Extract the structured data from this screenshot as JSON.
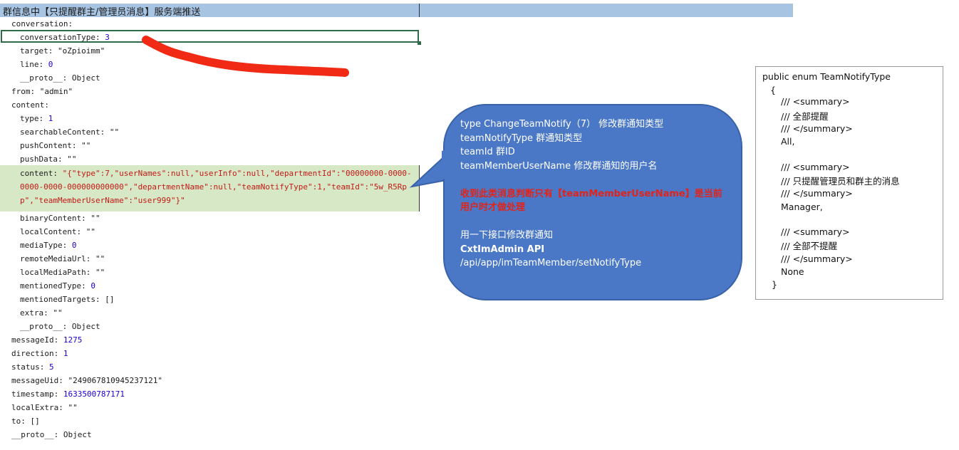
{
  "header": {
    "title": "群信息中【只提醒群主/管理员消息】服务端推送"
  },
  "tree": {
    "conversation_label": "conversation:",
    "conversationType_key": "conversationType:",
    "conversationType_val": "3",
    "target_key": "target:",
    "target_val": "\"oZpioimm\"",
    "line_key": "line:",
    "line_val": "0",
    "proto1": "__proto__: Object",
    "from_key": "from:",
    "from_val": "\"admin\"",
    "content_label": "content:",
    "type_key": "type:",
    "type_val": "1",
    "searchableContent": "searchableContent: \"\"",
    "pushContent": "pushContent: \"\"",
    "pushData": "pushData: \"\"",
    "content_key": "content:",
    "content_val": "\"{\"type\":7,\"userNames\":null,\"userInfo\":null,\"departmentId\":\"00000000-0000-0000-0000-000000000000\",\"departmentName\":null,\"teamNotifyType\":1,\"teamId\":\"5w_R5Rpp\",\"teamMemberUserName\":\"user999\"}\"",
    "binaryContent": "binaryContent: \"\"",
    "localContent": "localContent: \"\"",
    "mediaType_key": "mediaType:",
    "mediaType_val": "0",
    "remoteMediaUrl": "remoteMediaUrl: \"\"",
    "localMediaPath": "localMediaPath: \"\"",
    "mentionedType_key": "mentionedType:",
    "mentionedType_val": "0",
    "mentionedTargets": "mentionedTargets: []",
    "extra": "extra: \"\"",
    "proto2": "__proto__: Object",
    "messageId_key": "messageId:",
    "messageId_val": "1275",
    "direction_key": "direction:",
    "direction_val": "1",
    "status_key": "status:",
    "status_val": "5",
    "messageUid_key": "messageUid:",
    "messageUid_val": "\"249067810945237121\"",
    "timestamp_key": "timestamp:",
    "timestamp_val": "1633500787171",
    "localExtra": "localExtra: \"\"",
    "to": "to: []",
    "proto3": "__proto__: Object"
  },
  "bubble": {
    "l1": "type  ChangeTeamNotify（7） 修改群通知类型",
    "l2": "teamNotifyType  群通知类型",
    "l3": "teamId  群ID",
    "l4": "teamMemberUserName  修改群通知的用户名",
    "l5": "收到此类消息判断只有【teamMemberUserName】是当前",
    "l6": "用户时才做处理",
    "l7": "用一下接口修改群通知",
    "l8": "CxtImAdmin API",
    "l9": "/api/app/imTeamMember/setNotifyType"
  },
  "enum": {
    "l1": "public enum TeamNotifyType",
    "l2": "{",
    "l3": "/// <summary>",
    "l4": "/// 全部提醒",
    "l5": "/// </summary>",
    "l6": "All,",
    "l7": "/// <summary>",
    "l8": "/// 只提醒管理员和群主的消息",
    "l9": "/// </summary>",
    "l10": "Manager,",
    "l11": "/// <summary>",
    "l12": "/// 全部不提醒",
    "l13": "/// </summary>",
    "l14": "None",
    "l15": "}"
  },
  "colors": {
    "header": "#a8c4e3",
    "highlight": "#d7e8c6",
    "bubble": "#4a78c6",
    "annotation_stroke": "#f02a14"
  }
}
